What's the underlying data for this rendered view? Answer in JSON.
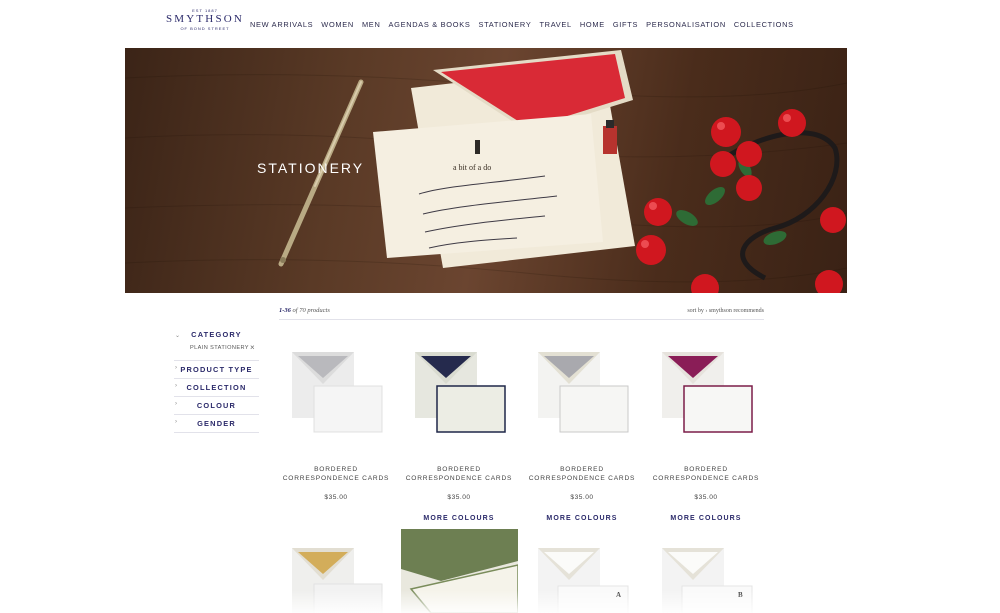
{
  "header": {
    "logo": {
      "est": "EST 1887",
      "brand": "SMYTHSON",
      "sub": "OF BOND STREET"
    },
    "nav": [
      "NEW ARRIVALS",
      "WOMEN",
      "MEN",
      "AGENDAS & BOOKS",
      "STATIONERY",
      "TRAVEL",
      "HOME",
      "GIFTS",
      "PERSONALISATION",
      "COLLECTIONS"
    ]
  },
  "hero": {
    "title": "STATIONERY"
  },
  "results": {
    "range": "1-36",
    "of_text": "of 70 products",
    "sort_label": "sort by",
    "sort_value": "smythson recommends"
  },
  "filters": {
    "category": {
      "label": "CATEGORY",
      "chip": "PLAIN STATIONERY",
      "chip_remove": "×"
    },
    "others": [
      "PRODUCT TYPE",
      "COLLECTION",
      "COLOUR",
      "GENDER"
    ]
  },
  "products": [
    {
      "name_line1": "BORDERED",
      "name_line2": "CORRESPONDENCE CARDS",
      "price": "$35.00",
      "lining": "#b9b9bd",
      "border": "#d6d6d6",
      "card": "#f1f1f1"
    },
    {
      "name_line1": "BORDERED",
      "name_line2": "CORRESPONDENCE CARDS",
      "price": "$35.00",
      "more": "MORE COLOURS",
      "lining": "#252a4d",
      "border": "#1f2748",
      "card": "#ecede4"
    },
    {
      "name_line1": "BORDERED",
      "name_line2": "CORRESPONDENCE CARDS",
      "price": "$35.00",
      "more": "MORE COLOURS",
      "lining": "#a9a9ae",
      "border": "#c9c9c9",
      "card": "#f6f6f4"
    },
    {
      "name_line1": "BORDERED",
      "name_line2": "CORRESPONDENCE CARDS",
      "price": "$35.00",
      "more": "MORE COLOURS",
      "lining": "#8a1d57",
      "border": "#7b1d48",
      "card": "#f7f7f5"
    }
  ],
  "products_row2": [
    {
      "lining": "#d3ad5a"
    },
    {
      "lining": "#6d7f52"
    },
    {
      "letter": "A"
    },
    {
      "letter": "B"
    }
  ],
  "colors": {
    "accent": "#2b2a6a",
    "hero_wood": "#5a3a26"
  }
}
